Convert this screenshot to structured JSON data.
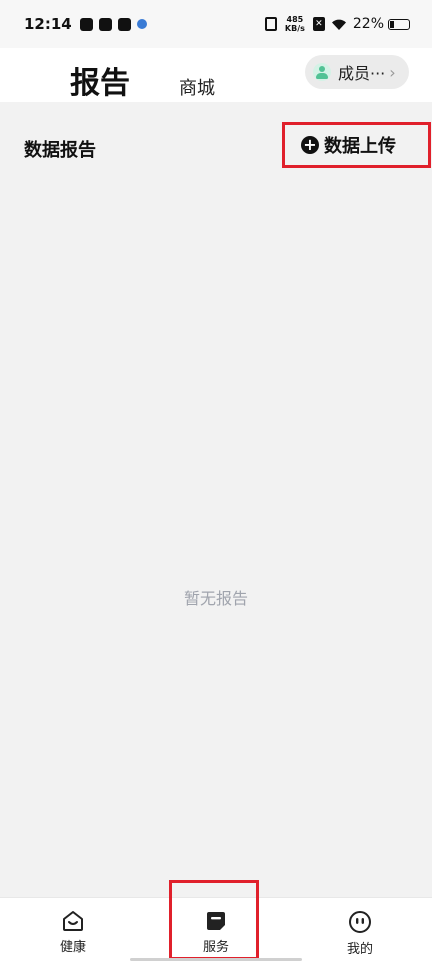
{
  "status_bar": {
    "time": "12:14",
    "net_speed_value": "485",
    "net_speed_unit": "KB/s",
    "battery": "22%"
  },
  "top_nav": {
    "tab_report": "报告",
    "tab_mall": "商城",
    "member_label": "成员···",
    "member_chevron": "›"
  },
  "main": {
    "section_title": "数据报告",
    "upload_label": "数据上传",
    "empty_text": "暂无报告"
  },
  "bottom_nav": {
    "items": [
      {
        "label": "健康",
        "icon": "house-smile-icon"
      },
      {
        "label": "服务",
        "icon": "note-icon"
      },
      {
        "label": "我的",
        "icon": "face-icon"
      }
    ]
  },
  "colors": {
    "accent_outline": "#e0202b",
    "background": "#f2f2f2",
    "empty_text": "#a0a4ad"
  }
}
